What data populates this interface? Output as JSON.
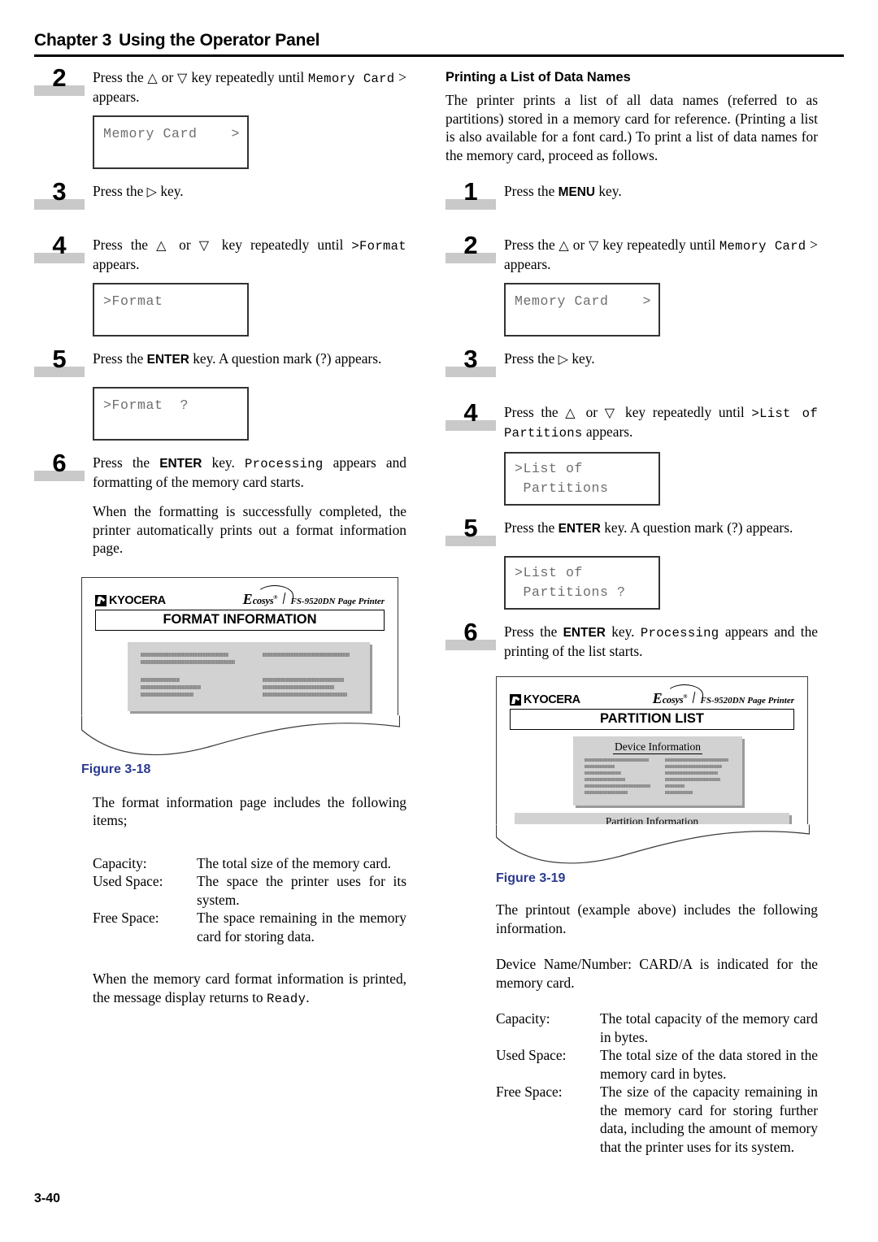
{
  "header": {
    "chapter_label": "Chapter 3",
    "chapter_title": "Using the Operator Panel"
  },
  "footer": {
    "page_number": "3-40"
  },
  "left_column": {
    "step2": {
      "number": "2",
      "text_before": "Press the ",
      "arrow_up": "△",
      "text_or": " or ",
      "arrow_down": "▽",
      "text_after": " key repeatedly until ",
      "mono_value": "Memory Card",
      "text_end": "> appears.",
      "lcd": "Memory Card    >"
    },
    "step3": {
      "number": "3",
      "text": "Press the ",
      "arrow_right": "▷",
      "text_end": " key."
    },
    "step4": {
      "number": "4",
      "text_before": "Press the ",
      "arrow_up": "△",
      "text_or": " or ",
      "arrow_down": "▽",
      "text_after": " key repeatedly until ",
      "mono_value": ">Format",
      "text_end": " appears.",
      "lcd": ">Format"
    },
    "step5": {
      "number": "5",
      "text_before": "Press the ",
      "key_label": "ENTER",
      "text_after": " key. A question mark (?) appears.",
      "lcd": ">Format  ?"
    },
    "step6": {
      "number": "6",
      "text_before": "Press the ",
      "key_label": "ENTER",
      "text_mid": " key. ",
      "mono_value": "Processing",
      "text_after": " appears and formatting of the memory card starts."
    },
    "paragraph_after_step6": "When the formatting is successfully completed, the printer automatically prints out a format information page.",
    "figure": {
      "brand": "KYOCERA",
      "ecosys_big": "E",
      "ecosys_small": "cosys",
      "ecosys_reg": "®",
      "model": "FS-9520DN  Page Printer",
      "title": "FORMAT INFORMATION",
      "caption": "Figure 3-18"
    },
    "intro_items": "The format information page includes the following items;",
    "definitions": [
      {
        "term": "Capacity:",
        "desc": "The total size of the memory card."
      },
      {
        "term": "Used Space:",
        "desc": "The space the printer uses for its system."
      },
      {
        "term": "Free Space:",
        "desc": "The space remaining in the memory card for storing data."
      }
    ],
    "closing_before": "When the memory card format information is printed, the message display returns to ",
    "closing_mono": "Ready",
    "closing_after": "."
  },
  "right_column": {
    "section_heading": "Printing a List of Data Names",
    "section_intro": "The printer prints a list of all data names (referred to as partitions) stored in a memory card for reference. (Printing a list is also available for a font card.) To print a list of data names for the memory card, proceed as follows.",
    "step1": {
      "number": "1",
      "text_before": "Press the ",
      "key_label": "MENU",
      "text_after": " key."
    },
    "step2": {
      "number": "2",
      "text_before": "Press the ",
      "arrow_up": "△",
      "text_or": " or ",
      "arrow_down": "▽",
      "text_after": " key repeatedly until ",
      "mono_value": "Memory Card",
      "text_end": "> appears.",
      "lcd": "Memory Card    >"
    },
    "step3": {
      "number": "3",
      "text": "Press the ",
      "arrow_right": "▷",
      "text_end": " key."
    },
    "step4": {
      "number": "4",
      "text_before": "Press the ",
      "arrow_up": "△",
      "text_or": " or ",
      "arrow_down": "▽",
      "text_after": " key repeatedly until ",
      "mono_value": ">List of",
      "mono_value2": "Partitions",
      "text_end": " appears.",
      "lcd_line1": ">List of",
      "lcd_line2": " Partitions"
    },
    "step5": {
      "number": "5",
      "text_before": "Press the ",
      "key_label": "ENTER",
      "text_after": " key. A question mark (?) appears.",
      "lcd_line1": ">List of",
      "lcd_line2": " Partitions ?"
    },
    "step6": {
      "number": "6",
      "text_before": "Press the ",
      "key_label": "ENTER",
      "text_mid": " key. ",
      "mono_value": "Processing",
      "text_after": " appears and the printing of the list starts."
    },
    "figure": {
      "brand": "KYOCERA",
      "ecosys_big": "E",
      "ecosys_small": "cosys",
      "ecosys_reg": "®",
      "model": "FS-9520DN  Page Printer",
      "title": "PARTITION LIST",
      "section_device": "Device Information",
      "section_partition": "Partition Information",
      "caption": "Figure 3-19"
    },
    "printout_intro": "The printout (example above) includes the following information.",
    "device_note": "Device Name/Number: CARD/A is indicated for the memory card.",
    "definitions": [
      {
        "term": "Capacity:",
        "desc": "The total capacity of the memory card in bytes."
      },
      {
        "term": "Used Space:",
        "desc": "The total size of the data stored in the memory card in bytes."
      },
      {
        "term": "Free Space:",
        "desc": "The size of the capacity remaining in the memory card for storing further data, including the amount of memory that the printer uses for its system."
      }
    ]
  },
  "colors": {
    "caption": "#2b3a8f",
    "step_bar": "#c9c9c9",
    "figure_gray": "#d2d2d2",
    "lcd_text": "#6e6e6e"
  }
}
